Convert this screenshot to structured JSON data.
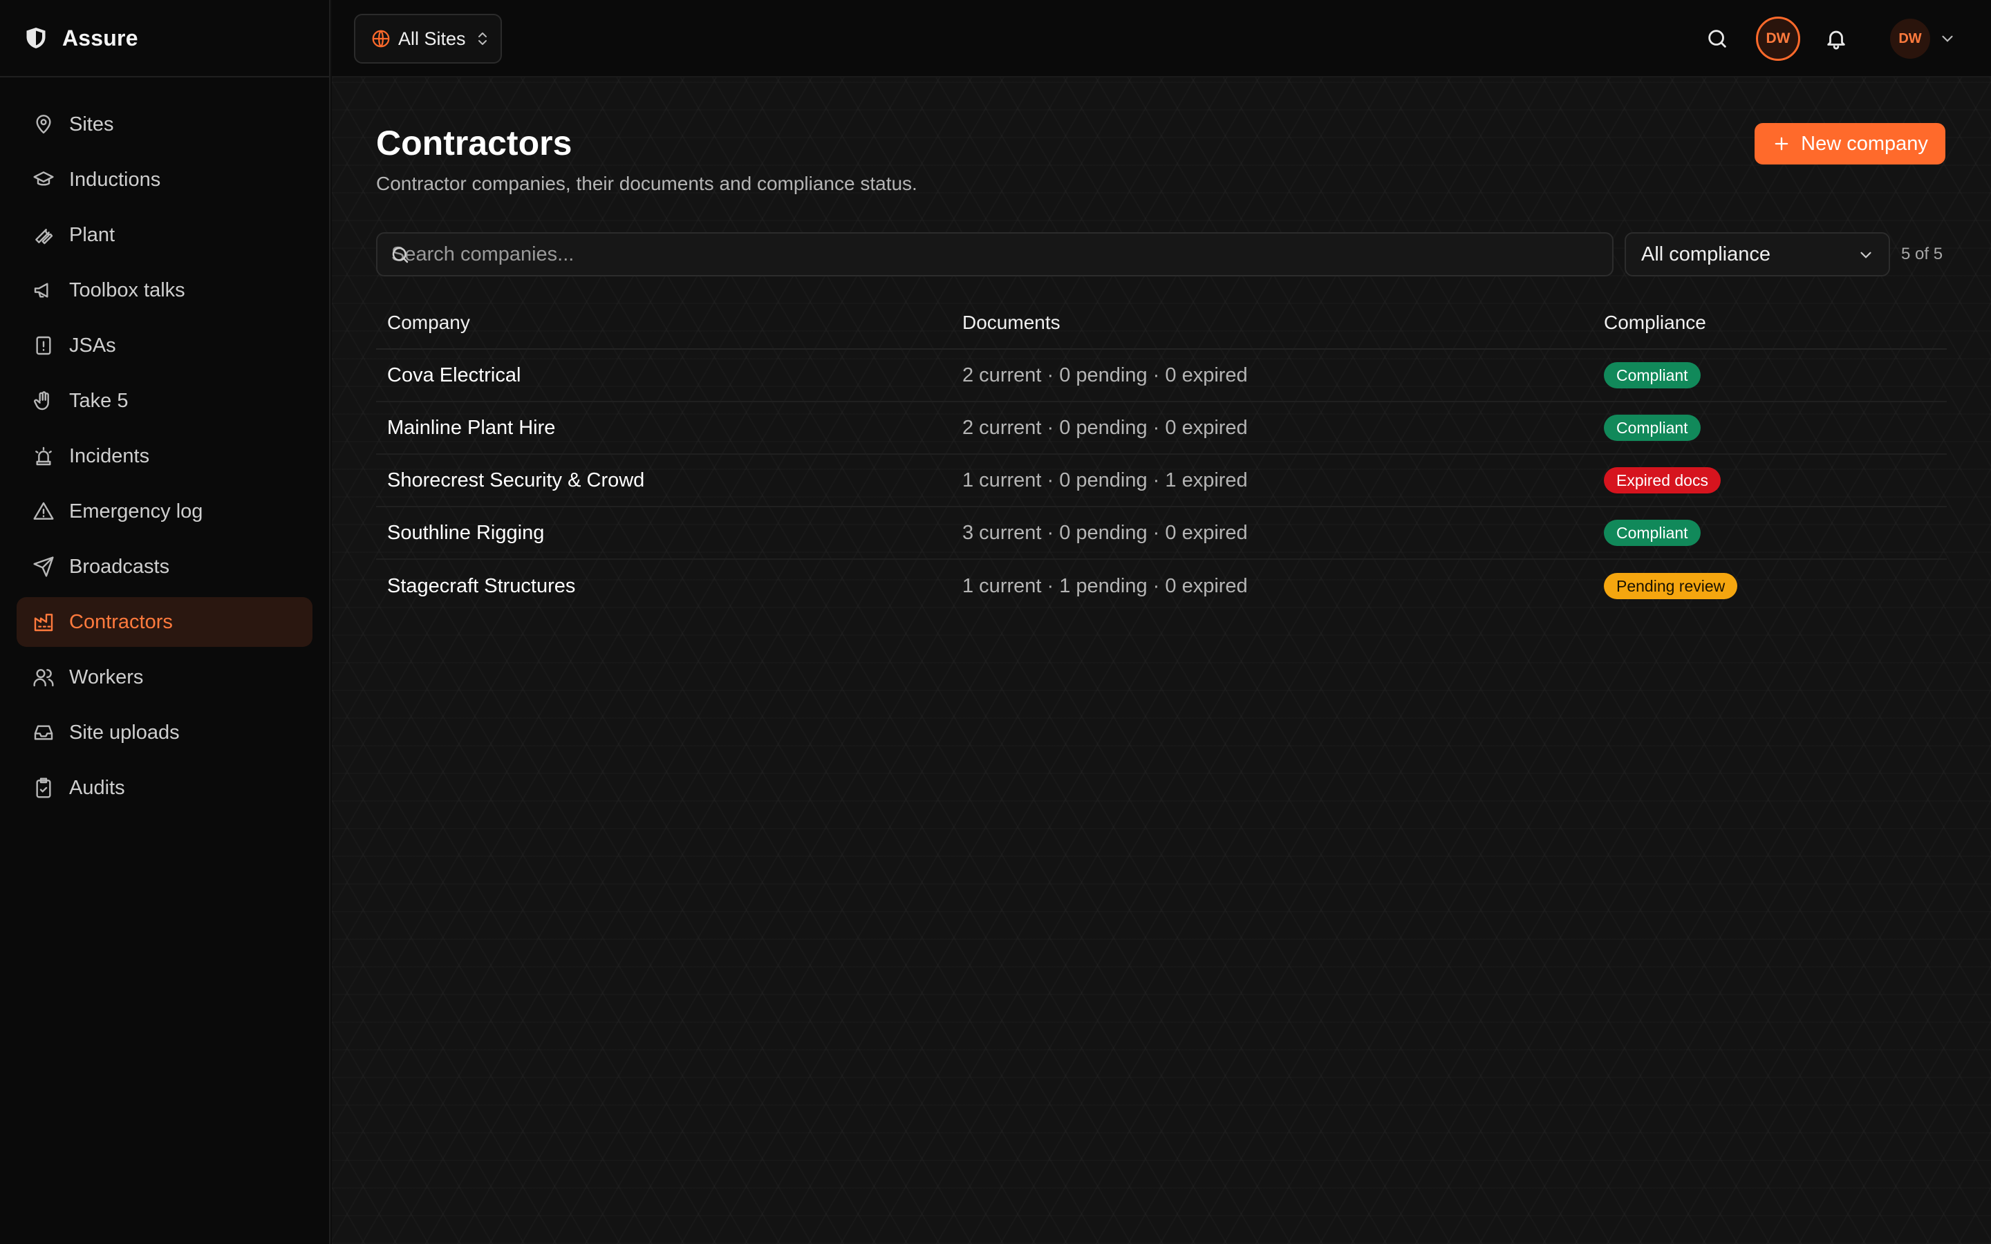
{
  "app": {
    "name": "Assure"
  },
  "sidebar": {
    "items": [
      {
        "label": "Sites",
        "icon": "map-pin-icon",
        "active": false
      },
      {
        "label": "Inductions",
        "icon": "graduation-cap-icon",
        "active": false
      },
      {
        "label": "Plant",
        "icon": "wrench-icon",
        "active": false
      },
      {
        "label": "Toolbox talks",
        "icon": "megaphone-icon",
        "active": false
      },
      {
        "label": "JSAs",
        "icon": "file-alert-icon",
        "active": false
      },
      {
        "label": "Take 5",
        "icon": "hand-icon",
        "active": false
      },
      {
        "label": "Incidents",
        "icon": "siren-icon",
        "active": false
      },
      {
        "label": "Emergency log",
        "icon": "warning-triangle-icon",
        "active": false
      },
      {
        "label": "Broadcasts",
        "icon": "send-icon",
        "active": false
      },
      {
        "label": "Contractors",
        "icon": "factory-icon",
        "active": true
      },
      {
        "label": "Workers",
        "icon": "users-icon",
        "active": false
      },
      {
        "label": "Site uploads",
        "icon": "inbox-icon",
        "active": false
      },
      {
        "label": "Audits",
        "icon": "clipboard-check-icon",
        "active": false
      }
    ]
  },
  "topbar": {
    "site_picker": "All Sites",
    "avatar_initials": "DW",
    "user_initials": "DW"
  },
  "page": {
    "title": "Contractors",
    "subtitle": "Contractor companies, their documents and compliance status.",
    "new_button": "New company"
  },
  "filters": {
    "search_placeholder": "Search companies...",
    "compliance_select": "All compliance",
    "count": "5 of 5"
  },
  "table": {
    "headers": {
      "company": "Company",
      "documents": "Documents",
      "compliance": "Compliance"
    },
    "rows": [
      {
        "company": "Cova Electrical",
        "documents": "2 current · 0 pending · 0 expired",
        "compliance": "Compliant",
        "status": "green"
      },
      {
        "company": "Mainline Plant Hire",
        "documents": "2 current · 0 pending · 0 expired",
        "compliance": "Compliant",
        "status": "green"
      },
      {
        "company": "Shorecrest Security & Crowd",
        "documents": "1 current · 0 pending · 1 expired",
        "compliance": "Expired docs",
        "status": "red"
      },
      {
        "company": "Southline Rigging",
        "documents": "3 current · 0 pending · 0 expired",
        "compliance": "Compliant",
        "status": "green"
      },
      {
        "company": "Stagecraft Structures",
        "documents": "1 current · 1 pending · 0 expired",
        "compliance": "Pending review",
        "status": "amber"
      }
    ]
  },
  "colors": {
    "accent": "#ff6a2b",
    "compliant": "#11895a",
    "expired": "#d6141e",
    "pending": "#f5a60f"
  }
}
